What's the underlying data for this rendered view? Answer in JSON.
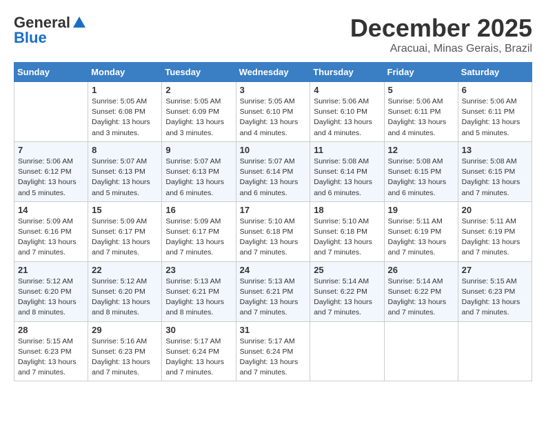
{
  "logo": {
    "general": "General",
    "blue": "Blue"
  },
  "header": {
    "month": "December 2025",
    "location": "Aracuai, Minas Gerais, Brazil"
  },
  "weekdays": [
    "Sunday",
    "Monday",
    "Tuesday",
    "Wednesday",
    "Thursday",
    "Friday",
    "Saturday"
  ],
  "weeks": [
    [
      {
        "day": "",
        "info": ""
      },
      {
        "day": "1",
        "info": "Sunrise: 5:05 AM\nSunset: 6:08 PM\nDaylight: 13 hours\nand 3 minutes."
      },
      {
        "day": "2",
        "info": "Sunrise: 5:05 AM\nSunset: 6:09 PM\nDaylight: 13 hours\nand 3 minutes."
      },
      {
        "day": "3",
        "info": "Sunrise: 5:05 AM\nSunset: 6:10 PM\nDaylight: 13 hours\nand 4 minutes."
      },
      {
        "day": "4",
        "info": "Sunrise: 5:06 AM\nSunset: 6:10 PM\nDaylight: 13 hours\nand 4 minutes."
      },
      {
        "day": "5",
        "info": "Sunrise: 5:06 AM\nSunset: 6:11 PM\nDaylight: 13 hours\nand 4 minutes."
      },
      {
        "day": "6",
        "info": "Sunrise: 5:06 AM\nSunset: 6:11 PM\nDaylight: 13 hours\nand 5 minutes."
      }
    ],
    [
      {
        "day": "7",
        "info": "Sunrise: 5:06 AM\nSunset: 6:12 PM\nDaylight: 13 hours\nand 5 minutes."
      },
      {
        "day": "8",
        "info": "Sunrise: 5:07 AM\nSunset: 6:13 PM\nDaylight: 13 hours\nand 5 minutes."
      },
      {
        "day": "9",
        "info": "Sunrise: 5:07 AM\nSunset: 6:13 PM\nDaylight: 13 hours\nand 6 minutes."
      },
      {
        "day": "10",
        "info": "Sunrise: 5:07 AM\nSunset: 6:14 PM\nDaylight: 13 hours\nand 6 minutes."
      },
      {
        "day": "11",
        "info": "Sunrise: 5:08 AM\nSunset: 6:14 PM\nDaylight: 13 hours\nand 6 minutes."
      },
      {
        "day": "12",
        "info": "Sunrise: 5:08 AM\nSunset: 6:15 PM\nDaylight: 13 hours\nand 6 minutes."
      },
      {
        "day": "13",
        "info": "Sunrise: 5:08 AM\nSunset: 6:15 PM\nDaylight: 13 hours\nand 7 minutes."
      }
    ],
    [
      {
        "day": "14",
        "info": "Sunrise: 5:09 AM\nSunset: 6:16 PM\nDaylight: 13 hours\nand 7 minutes."
      },
      {
        "day": "15",
        "info": "Sunrise: 5:09 AM\nSunset: 6:17 PM\nDaylight: 13 hours\nand 7 minutes."
      },
      {
        "day": "16",
        "info": "Sunrise: 5:09 AM\nSunset: 6:17 PM\nDaylight: 13 hours\nand 7 minutes."
      },
      {
        "day": "17",
        "info": "Sunrise: 5:10 AM\nSunset: 6:18 PM\nDaylight: 13 hours\nand 7 minutes."
      },
      {
        "day": "18",
        "info": "Sunrise: 5:10 AM\nSunset: 6:18 PM\nDaylight: 13 hours\nand 7 minutes."
      },
      {
        "day": "19",
        "info": "Sunrise: 5:11 AM\nSunset: 6:19 PM\nDaylight: 13 hours\nand 7 minutes."
      },
      {
        "day": "20",
        "info": "Sunrise: 5:11 AM\nSunset: 6:19 PM\nDaylight: 13 hours\nand 7 minutes."
      }
    ],
    [
      {
        "day": "21",
        "info": "Sunrise: 5:12 AM\nSunset: 6:20 PM\nDaylight: 13 hours\nand 8 minutes."
      },
      {
        "day": "22",
        "info": "Sunrise: 5:12 AM\nSunset: 6:20 PM\nDaylight: 13 hours\nand 8 minutes."
      },
      {
        "day": "23",
        "info": "Sunrise: 5:13 AM\nSunset: 6:21 PM\nDaylight: 13 hours\nand 8 minutes."
      },
      {
        "day": "24",
        "info": "Sunrise: 5:13 AM\nSunset: 6:21 PM\nDaylight: 13 hours\nand 7 minutes."
      },
      {
        "day": "25",
        "info": "Sunrise: 5:14 AM\nSunset: 6:22 PM\nDaylight: 13 hours\nand 7 minutes."
      },
      {
        "day": "26",
        "info": "Sunrise: 5:14 AM\nSunset: 6:22 PM\nDaylight: 13 hours\nand 7 minutes."
      },
      {
        "day": "27",
        "info": "Sunrise: 5:15 AM\nSunset: 6:23 PM\nDaylight: 13 hours\nand 7 minutes."
      }
    ],
    [
      {
        "day": "28",
        "info": "Sunrise: 5:15 AM\nSunset: 6:23 PM\nDaylight: 13 hours\nand 7 minutes."
      },
      {
        "day": "29",
        "info": "Sunrise: 5:16 AM\nSunset: 6:23 PM\nDaylight: 13 hours\nand 7 minutes."
      },
      {
        "day": "30",
        "info": "Sunrise: 5:17 AM\nSunset: 6:24 PM\nDaylight: 13 hours\nand 7 minutes."
      },
      {
        "day": "31",
        "info": "Sunrise: 5:17 AM\nSunset: 6:24 PM\nDaylight: 13 hours\nand 7 minutes."
      },
      {
        "day": "",
        "info": ""
      },
      {
        "day": "",
        "info": ""
      },
      {
        "day": "",
        "info": ""
      }
    ]
  ]
}
